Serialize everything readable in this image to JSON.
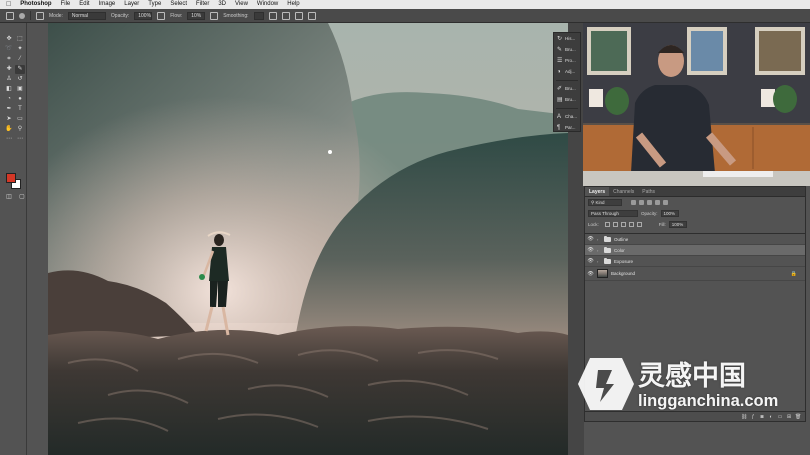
{
  "menubar": {
    "apple": "",
    "app_name": "Photoshop",
    "menus": [
      "File",
      "Edit",
      "Image",
      "Layer",
      "Type",
      "Select",
      "Filter",
      "3D",
      "View",
      "Window",
      "Help"
    ]
  },
  "options_bar": {
    "mode_label": "Mode:",
    "mode_value": "Normal",
    "opacity_label": "Opacity:",
    "opacity_value": "100%",
    "flow_label": "Flow:",
    "flow_value": "10%",
    "smoothing_label": "Smoothing:"
  },
  "colors": {
    "foreground": "#d43726",
    "background": "#ffffff",
    "ui_panel": "#535353"
  },
  "panel_strip": {
    "items": [
      "His...",
      "Bru...",
      "Pro...",
      "Adj...",
      "Bru...",
      "Bru...",
      "Cha...",
      "Par..."
    ]
  },
  "layers_panel": {
    "tabs": [
      "Layers",
      "Channels",
      "Paths"
    ],
    "filter_kind": "Kind",
    "blend_mode": "Pass Through",
    "opacity_label": "Opacity:",
    "opacity_value": "100%",
    "lock_label": "Lock:",
    "fill_label": "Fill:",
    "fill_value": "100%",
    "layers": [
      {
        "name": "Outline",
        "type": "group",
        "selected": false
      },
      {
        "name": "Color",
        "type": "group",
        "selected": true
      },
      {
        "name": "Exposure",
        "type": "group",
        "selected": false
      },
      {
        "name": "Background",
        "type": "pixel",
        "selected": false,
        "locked": true
      }
    ]
  },
  "watermark": {
    "chinese": "灵感中国",
    "url": "lingganchina.com"
  }
}
